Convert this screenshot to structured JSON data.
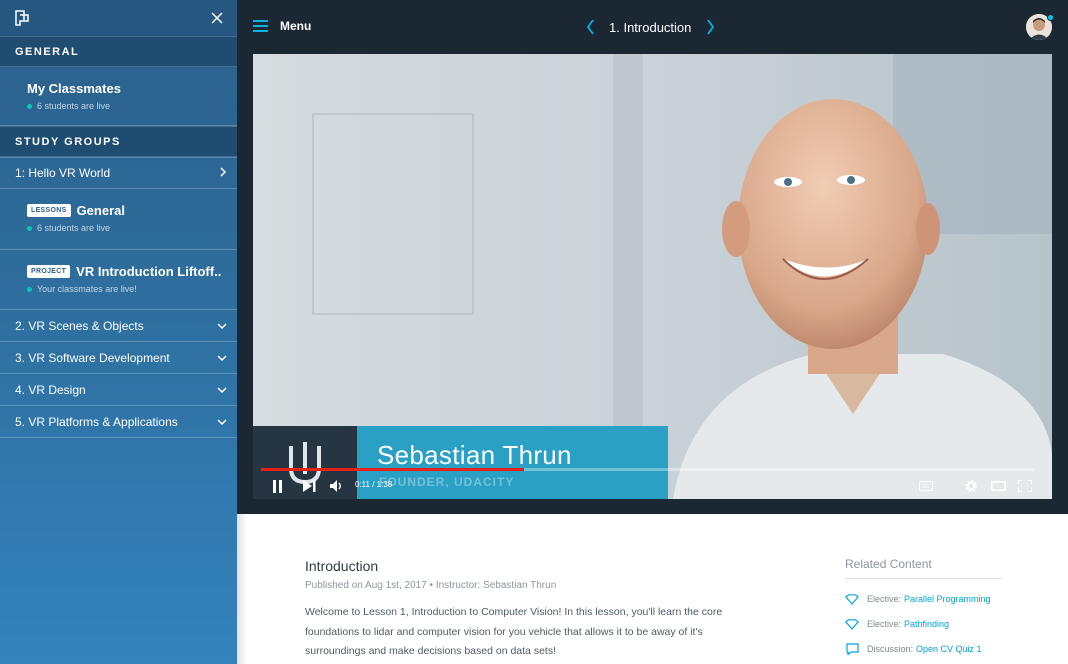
{
  "sidebar": {
    "general_heading": "GENERAL",
    "classmates": {
      "title": "My Classmates",
      "status": "6 students are live"
    },
    "study_groups_heading": "STUDY GROUPS",
    "active_group": "1: Hello VR World",
    "lesson": {
      "tag": "LESSONS",
      "title": "General",
      "status": "6 students are live"
    },
    "project": {
      "tag": "PROJECT",
      "title": "VR Introduction Liftoff...",
      "status": "Your classmates are live!"
    },
    "groups": [
      "2. VR Scenes & Objects",
      "3. VR Software Development",
      "4. VR Design",
      "5. VR Platforms & Applications"
    ]
  },
  "header": {
    "menu_label": "Menu",
    "lesson_title": "1. Introduction"
  },
  "video": {
    "presenter_name": "Sebastian Thrun",
    "presenter_role": "FOUNDER, UDACITY",
    "time": "0:11 / 1:38",
    "progress_fraction": 0.34
  },
  "content": {
    "title": "Introduction",
    "meta": "Published on Aug 1st, 2017 • Instructor: Sebastian Thrun",
    "description": "Welcome to Lesson 1, Introduction to Computer Vision! In this lesson, you'll learn the core foundations to lidar and computer vision for you vehicle that allows it to be away of it's surroundings and make decisions based on data sets!"
  },
  "related": {
    "heading": "Related Content",
    "items": [
      {
        "kind": "Elective:",
        "link": "Parallel Programming",
        "icon": "diamond-icon"
      },
      {
        "kind": "Elective:",
        "link": "Pathfinding",
        "icon": "diamond-icon"
      },
      {
        "kind": "Discussion:",
        "link": "Open CV Quiz 1",
        "icon": "chat-icon"
      }
    ]
  },
  "colors": {
    "accent": "#02b3e4",
    "live_dot": "#02c7b6",
    "progress": "#e62117",
    "lower_third": "#29a0c4"
  }
}
